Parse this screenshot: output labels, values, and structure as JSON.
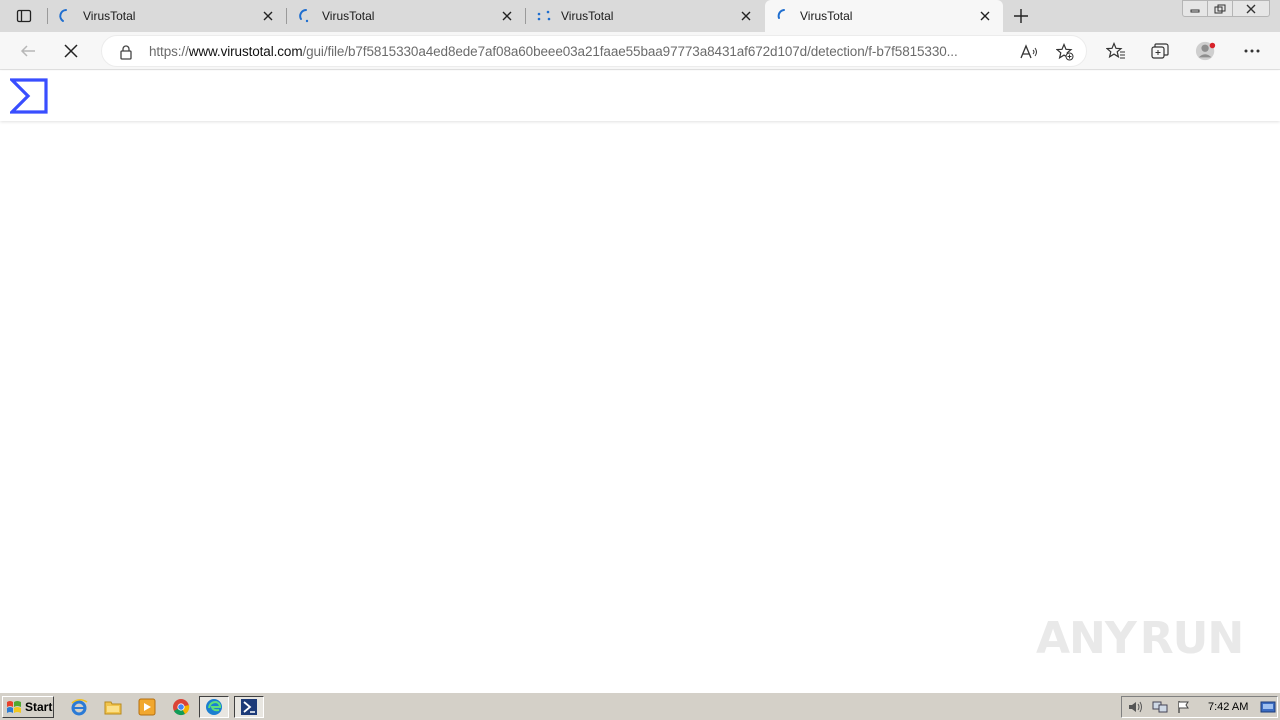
{
  "browser": {
    "tabs": [
      {
        "title": "VirusTotal",
        "active": false
      },
      {
        "title": "VirusTotal",
        "active": false
      },
      {
        "title": "VirusTotal",
        "active": false
      },
      {
        "title": "VirusTotal",
        "active": true
      }
    ],
    "url_prefix": "https://",
    "url_host": "www.virustotal.com",
    "url_path": "/gui/file/b7f5815330a4ed8ede7af08a60beee03a21faae55baa97773a8431af672d107d/detection/f-b7f5815330...",
    "loading": true
  },
  "page": {
    "watermark_left": "ANY",
    "watermark_right": "RUN"
  },
  "taskbar": {
    "start_label": "Start",
    "clock": "7:42 AM"
  },
  "colors": {
    "vt_logo_blue": "#394eff",
    "tab_loading_blue": "#1f6ecf"
  }
}
